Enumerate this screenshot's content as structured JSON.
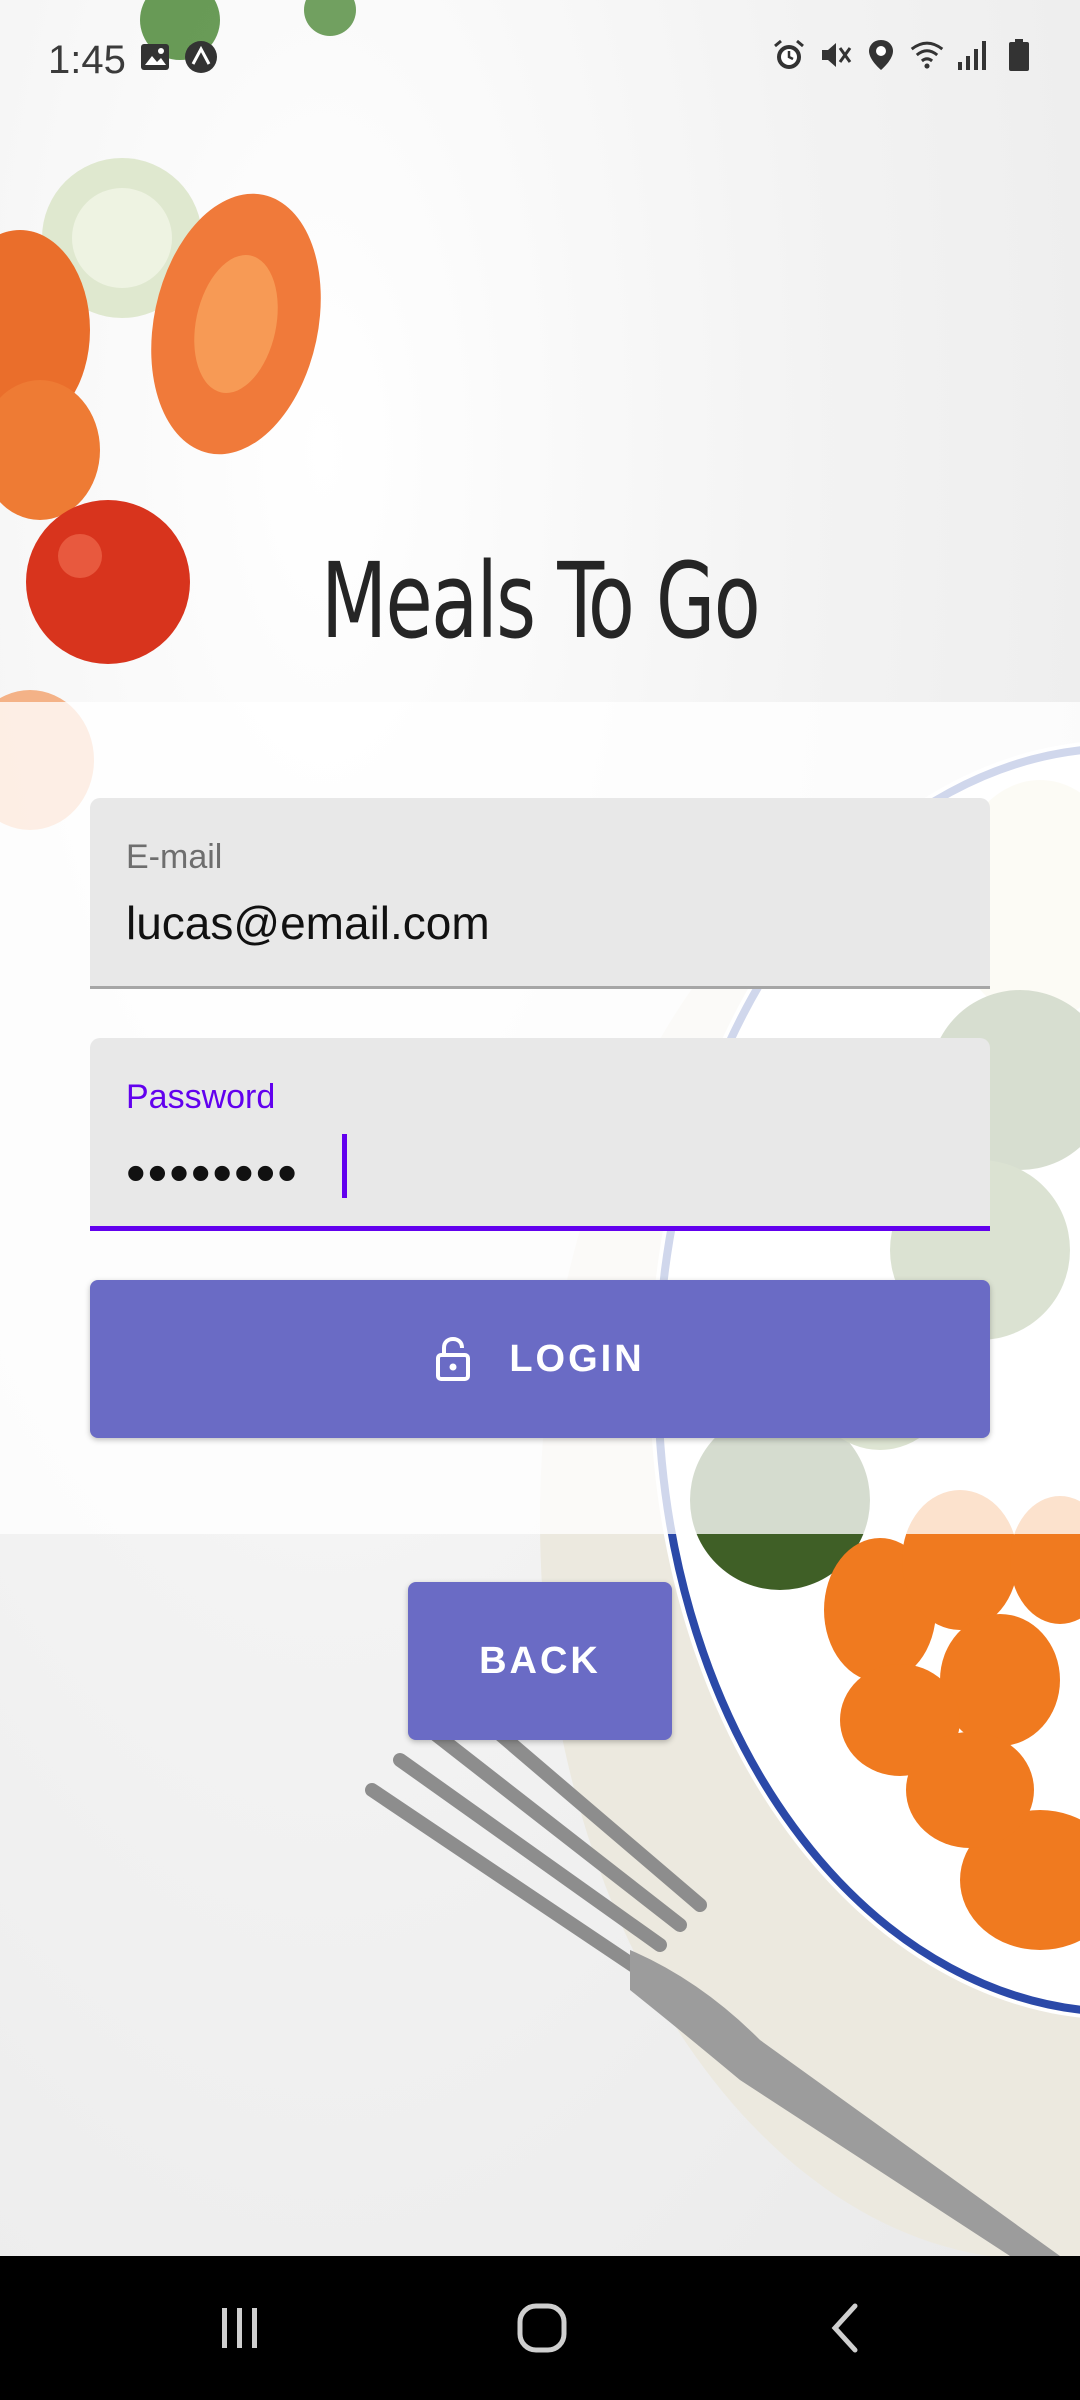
{
  "status_bar": {
    "time": "1:45",
    "icons": [
      "image-icon",
      "app-icon",
      "alarm-icon",
      "mute-icon",
      "location-icon",
      "wifi-icon",
      "signal-icon",
      "battery-icon"
    ]
  },
  "app": {
    "title": "Meals To Go"
  },
  "login_form": {
    "email": {
      "label": "E-mail",
      "value": "lucas@email.com"
    },
    "password": {
      "label": "Password",
      "masked_value": "••••••••"
    },
    "login_button": {
      "icon": "lock-open-icon",
      "label": "LOGIN"
    }
  },
  "back_button": {
    "label": "BACK"
  },
  "nav_bar": {
    "buttons": [
      "recents-icon",
      "home-icon",
      "back-icon"
    ]
  },
  "colors": {
    "primary": "#6a6bc5",
    "focus": "#6200ee",
    "field_bg": "#e8e8e8",
    "title_text": "#252525"
  }
}
